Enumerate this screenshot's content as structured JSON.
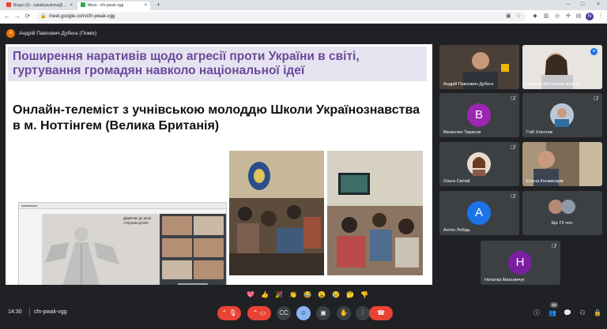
{
  "browser": {
    "tabs": [
      {
        "title": "Вхідні (5) - natalkaivakina@..."
      },
      {
        "title": "Meet - cfn-pwak-vgg"
      }
    ],
    "url": "meet.google.com/cfn-pwak-vgg",
    "profile_initial": "N"
  },
  "meet": {
    "presenter": {
      "initial": "А",
      "name": "Андрій Павлович Дубега (Поміх)"
    },
    "slide": {
      "title": "Поширення наративів щодо агресії проти України в світі, гуртування громадян навколо національної ідеї",
      "subtitle": "Онлайн-телеміст з учнівською молоддю Школи Українознавства в м. Ноттінгем (Велика Британія)",
      "photo_label": "Дідвчник до акції «Героям дітей»"
    },
    "participants": [
      {
        "name": "Андрій Павлович Дубега"
      },
      {
        "name": "Наталія Вікторівна Івакіна"
      },
      {
        "name": "Валентин Тарасов",
        "initial": "В",
        "color": "#9c27b0"
      },
      {
        "name": "Гліб Хлестов"
      },
      {
        "name": "Ольга Світай"
      },
      {
        "name": "Елена Косминарів"
      },
      {
        "name": "Антон Лебідь",
        "initial": "A",
        "color": "#1a73e8"
      },
      {
        "name": "Ще 73 чол."
      },
      {
        "name": "Наталка Максимчук",
        "initial": "Н",
        "color": "#7b1fa2"
      }
    ],
    "time": "14:30",
    "meeting_code": "cfn-pwak-vgg",
    "people_count": "83"
  }
}
